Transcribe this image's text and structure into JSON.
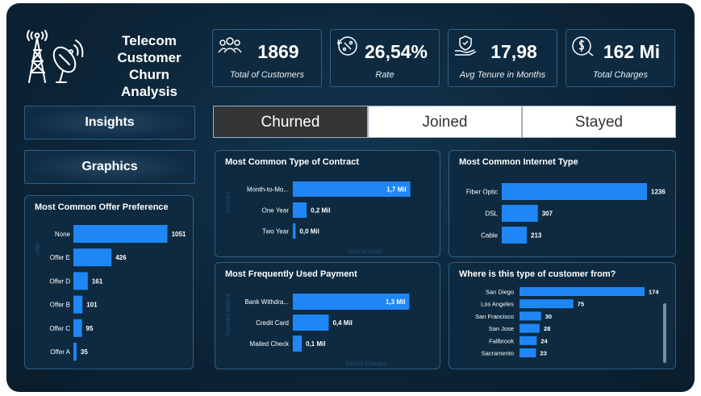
{
  "title": "Telecom Customer Churn Analysis",
  "title_lines": [
    "Telecom",
    "Customer Churn",
    "Analysis"
  ],
  "kpis": [
    {
      "value": "1869",
      "label": "Total of Customers",
      "icon": "users-icon"
    },
    {
      "value": "26,54%",
      "label": "Rate",
      "icon": "rate-cycle-icon"
    },
    {
      "value": "17,98",
      "label": "Avg Tenure in Months",
      "icon": "hand-shield-icon"
    },
    {
      "value": "162 Mi",
      "label": "Total Charges",
      "icon": "money-bag-icon"
    }
  ],
  "nav": {
    "insights": "Insights",
    "graphics": "Graphics"
  },
  "tabs": [
    {
      "label": "Churned",
      "active": true
    },
    {
      "label": "Joined",
      "active": false
    },
    {
      "label": "Stayed",
      "active": false
    }
  ],
  "colors": {
    "bar": "#1f87f5",
    "panel": "#0d2a40",
    "border": "#2f5f86"
  },
  "chart_data": [
    {
      "id": "offer",
      "type": "bar",
      "orientation": "horizontal",
      "title": "Most Common Offer Preference",
      "ylabel": "Offer",
      "categories": [
        "None",
        "Offer E",
        "Offer D",
        "Offer B",
        "Offer C",
        "Offer A"
      ],
      "values": [
        1051,
        426,
        161,
        101,
        95,
        35
      ],
      "labels": [
        "1051",
        "426",
        "161",
        "101",
        "95",
        "35"
      ],
      "xlim": [
        0,
        1100
      ],
      "label_inside": false
    },
    {
      "id": "contract",
      "type": "bar",
      "orientation": "horizontal",
      "title": "Most Common Type of Contract",
      "ylabel": "Contract",
      "xlabel": "Sum of Churn",
      "categories": [
        "Month-to-Mo...",
        "One Year",
        "Two Year"
      ],
      "values": [
        1.7,
        0.2,
        0.04
      ],
      "labels": [
        "1,7 Mil",
        "0,2 Mil",
        "0,0 Mil"
      ],
      "xlim": [
        0,
        1.75
      ],
      "label_inside": true
    },
    {
      "id": "internet",
      "type": "bar",
      "orientation": "horizontal",
      "title": "Most Common Internet Type",
      "categories": [
        "Fiber Optic",
        "DSL",
        "Cable"
      ],
      "values": [
        1236,
        307,
        213
      ],
      "labels": [
        "1236",
        "307",
        "213"
      ],
      "xlim": [
        0,
        1236
      ],
      "label_inside": false
    },
    {
      "id": "payment",
      "type": "bar",
      "orientation": "horizontal",
      "title": "Most Frequently Used Payment",
      "ylabel": "Payment Method",
      "xlabel": "Sum of Charges",
      "categories": [
        "Bank Withdra...",
        "Credit Card",
        "Mailed Check"
      ],
      "values": [
        1.3,
        0.4,
        0.1
      ],
      "labels": [
        "1,3 Mil",
        "0,4 Mil",
        "0,1 Mil"
      ],
      "xlim": [
        0,
        1.35
      ],
      "label_inside": true
    },
    {
      "id": "city",
      "type": "bar",
      "orientation": "horizontal",
      "title": "Where is this type of customer from?",
      "categories": [
        "San Diego",
        "Los Angeles",
        "San Francisco",
        "San Jose",
        "Fallbrook",
        "Sacramento"
      ],
      "values": [
        174,
        75,
        30,
        28,
        24,
        23
      ],
      "labels": [
        "174",
        "75",
        "30",
        "28",
        "24",
        "23"
      ],
      "xlim": [
        0,
        174
      ],
      "label_inside": false
    }
  ]
}
